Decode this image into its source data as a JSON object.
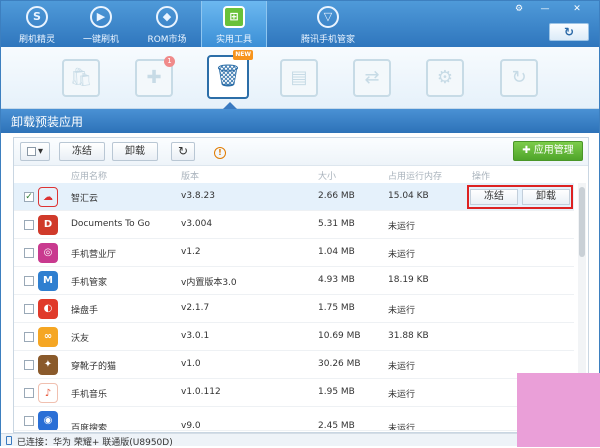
{
  "nav": {
    "tabs": [
      {
        "label": "刷机精灵",
        "icon": "S",
        "active": false
      },
      {
        "label": "一键刷机",
        "icon": "▶",
        "active": false
      },
      {
        "label": "ROM市场",
        "icon": "◆",
        "active": false
      },
      {
        "label": "实用工具",
        "icon": "⊞",
        "active": true
      },
      {
        "label": "腾讯手机管家",
        "icon": "▽",
        "active": false
      }
    ],
    "window_controls": {
      "settings": "⚙",
      "minimize": "—",
      "close": "✕"
    },
    "refresh_icon": "↻"
  },
  "tools": [
    {
      "icon": "🛍",
      "icon_name": "bag-icon"
    },
    {
      "icon": "✚",
      "icon_name": "puzzle-icon",
      "badge": "1"
    },
    {
      "icon": "🗑",
      "icon_name": "trash-icon",
      "tag": "NEW",
      "active": true
    },
    {
      "icon": "▤",
      "icon_name": "document-icon"
    },
    {
      "icon": "⇄",
      "icon_name": "transfer-icon"
    },
    {
      "icon": "⚙",
      "icon_name": "settings-icon"
    },
    {
      "icon": "↻",
      "icon_name": "sync-icon"
    }
  ],
  "section": {
    "title": "卸载预装应用"
  },
  "toolbar": {
    "select_all": "▾",
    "freeze": "冻结",
    "uninstall": "卸载",
    "refresh": "↻",
    "warning": "!",
    "app_manage": "应用管理"
  },
  "table": {
    "headers": {
      "name": "应用名称",
      "version": "版本",
      "size": "大小",
      "memory": "占用运行内存",
      "action": "操作"
    },
    "rows": [
      {
        "name": "智汇云",
        "version": "v3.8.23",
        "size": "2.66 MB",
        "memory": "15.04 KB",
        "checked": true,
        "color": "#ffffff",
        "glyph": "☁"
      },
      {
        "name": "Documents To Go",
        "version": "v3.004",
        "size": "5.31 MB",
        "memory": "未运行",
        "checked": false,
        "color": "#d03a2a",
        "glyph": "D"
      },
      {
        "name": "手机营业厅",
        "version": "v1.2",
        "size": "1.04 MB",
        "memory": "未运行",
        "checked": false,
        "color": "#c93a8f",
        "glyph": "◎"
      },
      {
        "name": "手机管家",
        "version": "v内置版本3.0",
        "size": "4.93 MB",
        "memory": "18.19 KB",
        "checked": false,
        "color": "#2f7fd0",
        "glyph": "M"
      },
      {
        "name": "操盘手",
        "version": "v2.1.7",
        "size": "1.75 MB",
        "memory": "未运行",
        "checked": false,
        "color": "#e03a2a",
        "glyph": "◐"
      },
      {
        "name": "沃友",
        "version": "v3.0.1",
        "size": "10.69 MB",
        "memory": "31.88 KB",
        "checked": false,
        "color": "#f5a623",
        "glyph": "∞"
      },
      {
        "name": "穿靴子的猫",
        "version": "v1.0",
        "size": "30.26 MB",
        "memory": "未运行",
        "checked": false,
        "color": "#8a5a2b",
        "glyph": "✦"
      },
      {
        "name": "手机音乐",
        "version": "v1.0.112",
        "size": "1.95 MB",
        "memory": "未运行",
        "checked": false,
        "color": "#e8573a",
        "glyph": "♪"
      },
      {
        "name": "百度搜索",
        "version": "v9.0",
        "size": "2.45 MB",
        "memory": "未运行",
        "checked": false,
        "color": "#2a6fd6",
        "glyph": "◉"
      }
    ],
    "row_actions": {
      "freeze": "冻结",
      "uninstall": "卸载"
    }
  },
  "status": {
    "text": "已连接：华为 荣耀+ 联通版(U8950D)"
  }
}
